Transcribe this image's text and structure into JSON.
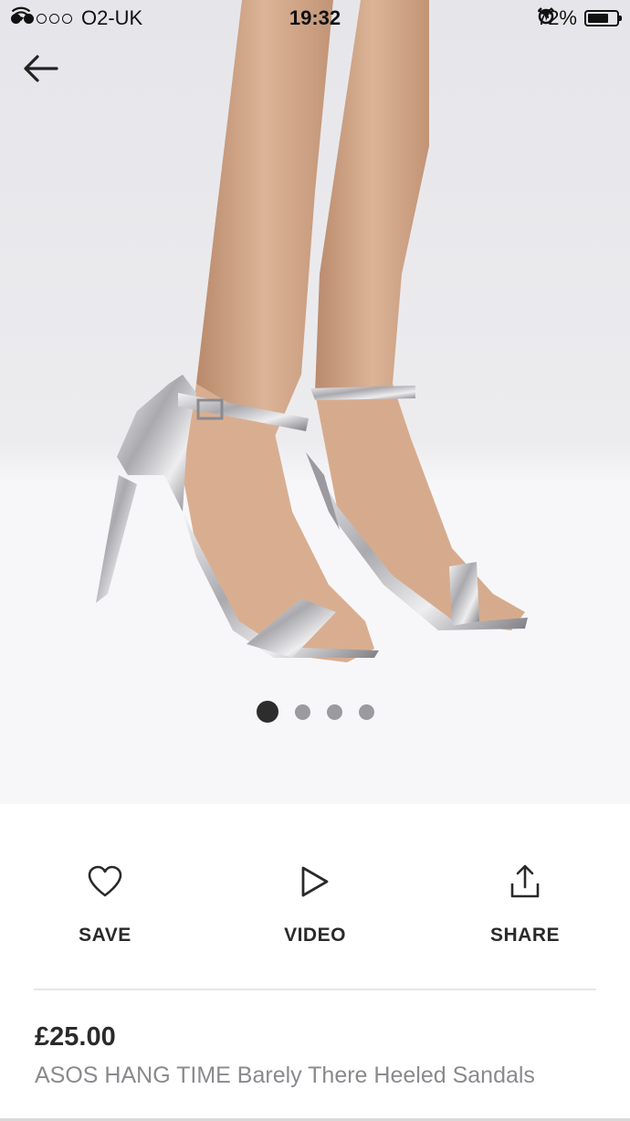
{
  "status_bar": {
    "carrier": "O2-UK",
    "time": "19:32",
    "battery": "72%",
    "signal_filled": 2,
    "signal_total": 5,
    "battery_level": 0.72
  },
  "gallery": {
    "pages": 4,
    "active_page": 1
  },
  "actions": {
    "save_label": "SAVE",
    "video_label": "VIDEO",
    "share_label": "SHARE"
  },
  "product": {
    "price": "£25.00",
    "name": "ASOS HANG TIME Barely There Heeled Sandals"
  },
  "icons": {
    "back": "arrow-left-icon",
    "save": "heart-icon",
    "video": "play-icon",
    "share": "share-icon"
  }
}
